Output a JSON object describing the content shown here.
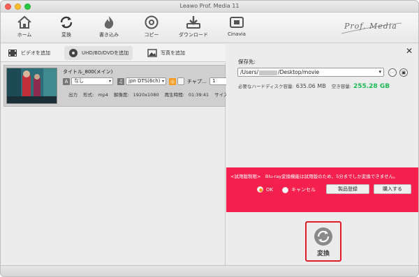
{
  "window": {
    "title": "Leawo Prof. Media 11"
  },
  "toolbar": {
    "items": [
      {
        "label": "ホーム",
        "icon": "home-icon"
      },
      {
        "label": "変換",
        "icon": "convert-icon"
      },
      {
        "label": "書き込み",
        "icon": "burn-icon"
      },
      {
        "label": "コピー",
        "icon": "copy-disc-icon"
      },
      {
        "label": "ダウンロード",
        "icon": "download-icon"
      },
      {
        "label": "Cinavia",
        "icon": "cinavia-icon"
      }
    ],
    "brand": "Prof. Media"
  },
  "tabs": [
    {
      "label": "ビデオを追加",
      "icon": "film-icon"
    },
    {
      "label": "UHD/BD/DVDを追加",
      "icon": "disc-icon"
    },
    {
      "label": "写真を追加",
      "icon": "photo-icon"
    }
  ],
  "item": {
    "title": "タイトル_800(メイン)",
    "subtitle": "なし",
    "audio": "jpn DTS(6ch)",
    "chapter_label": "チャプ...",
    "chapter_value": "1",
    "output_label": "出力",
    "format_label": "形式:",
    "format_value": "mp4",
    "resolution_label": "解像度:",
    "resolution_value": "1920x1080",
    "duration_label": "再生時間:",
    "duration_value": "01:39:41",
    "size_label": "サイズ:"
  },
  "save": {
    "label": "保存先:",
    "path_prefix": "/Users/",
    "path_suffix": "/Desktop/movie",
    "disk_required_label": "必要なハードディスク容量:",
    "disk_required_value": "635.06 MB",
    "disk_free_label": "空き容量:",
    "disk_free_value": "255.28 GB"
  },
  "trial": {
    "message": "<試用版制限>　Blu-ray変換機能は試用版のため、5分までしか変換できません。",
    "ok_label": "OK",
    "cancel_label": "キャンセル",
    "register_label": "製品登録",
    "buy_label": "購入する"
  },
  "convert": {
    "label": "変換"
  },
  "colors": {
    "trial_bg": "#f5204d",
    "free_space": "#1db954",
    "highlight": "#e21d2b",
    "radio_on": "#f59b22"
  }
}
